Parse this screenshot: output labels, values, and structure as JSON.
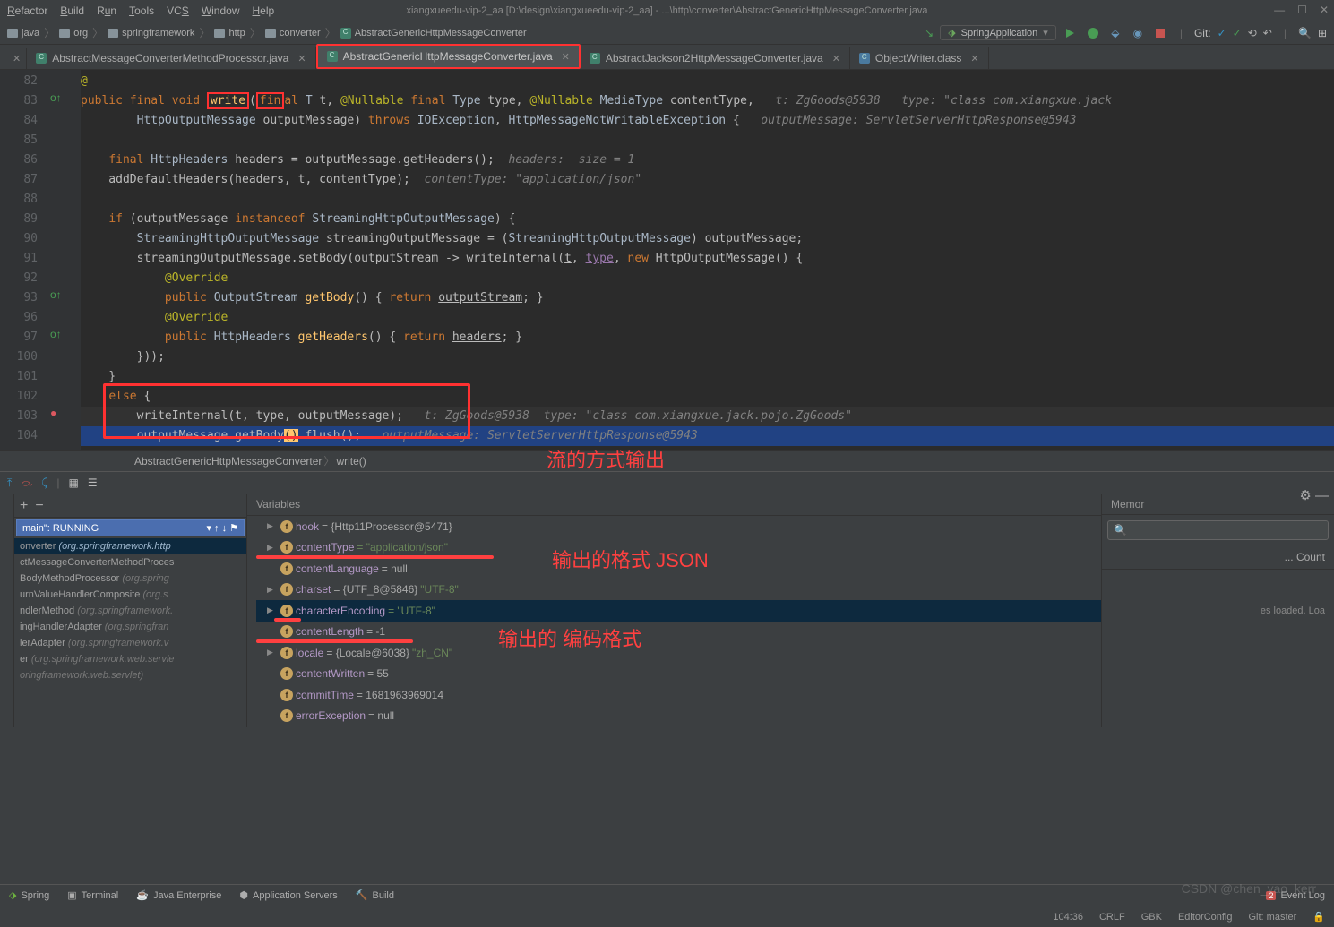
{
  "menubar": {
    "items": [
      "Refactor",
      "Build",
      "Run",
      "Tools",
      "VCS",
      "Window",
      "Help"
    ]
  },
  "window_title": "xiangxueedu-vip-2_aa [D:\\design\\xiangxueedu-vip-2_aa] - ...\\http\\converter\\AbstractGenericHttpMessageConverter.java",
  "breadcrumbs": [
    "java",
    "org",
    "springframework",
    "http",
    "converter",
    "AbstractGenericHttpMessageConverter"
  ],
  "run_config": {
    "name": "SpringApplication"
  },
  "git_label": "Git:",
  "tabs": [
    {
      "name": "AbstractMessageConverterMethodProcessor.java",
      "active": false
    },
    {
      "name": "AbstractGenericHttpMessageConverter.java",
      "active": true,
      "boxed": true
    },
    {
      "name": "AbstractJackson2HttpMessageConverter.java",
      "active": false
    },
    {
      "name": "ObjectWriter.class",
      "active": false,
      "icon": "class"
    }
  ],
  "code_breadcrumb": {
    "class": "AbstractGenericHttpMessageConverter",
    "method": "write()"
  },
  "lines": {
    "start": 82,
    "list": [
      82,
      83,
      84,
      85,
      86,
      87,
      88,
      89,
      90,
      91,
      92,
      93,
      96,
      97,
      100,
      101,
      102,
      103,
      104
    ]
  },
  "code_text": {
    "l82": "@",
    "l83_hint": "t: ZgGoods@5938   type: \"class com.xiangxue.jack",
    "l84_hint": "outputMessage: ServletServerHttpResponse@5943",
    "l86_hint": "headers:  size = 1",
    "l87_hint": "contentType: \"application/json\"",
    "l103_hint": "t: ZgGoods@5938  type: \"class com.xiangxue.jack.pojo.ZgGoods\"",
    "l104_hint": "outputMessage: ServletServerHttpResponse@5943"
  },
  "annotations": {
    "stream_output": "流的方式输出",
    "output_format": "输出的格式  JSON",
    "output_encoding": "输出的 编码格式"
  },
  "frames": {
    "dropdown": "main\": RUNNING",
    "items": [
      {
        "text": "onverter",
        "pkg": "(org.springframework.http",
        "sel": true
      },
      {
        "text": "ctMessageConverterMethodProces",
        "pkg": ""
      },
      {
        "text": "BodyMethodProcessor",
        "pkg": "(org.spring"
      },
      {
        "text": "urnValueHandlerComposite",
        "pkg": "(org.s"
      },
      {
        "text": "ndlerMethod",
        "pkg": "(org.springframework."
      },
      {
        "text": "ingHandlerAdapter",
        "pkg": "(org.springfran"
      },
      {
        "text": "lerAdapter",
        "pkg": "(org.springframework.v"
      },
      {
        "text": "er",
        "pkg": "(org.springframework.web.servle"
      },
      {
        "text": "oringframework.web.servlet)",
        "pkg": ""
      }
    ]
  },
  "variables": {
    "title": "Variables",
    "rows": [
      {
        "arrow": "▶",
        "name": "hook",
        "val": "= {Http11Processor@5471}"
      },
      {
        "arrow": "▶",
        "name": "contentType",
        "str": " = \"application/json\""
      },
      {
        "arrow": "",
        "name": "contentLanguage",
        "val": " = null"
      },
      {
        "arrow": "▶",
        "name": "charset",
        "val": " = {UTF_8@5846}",
        "str": " \"UTF-8\""
      },
      {
        "arrow": "▶",
        "name": "characterEncoding",
        "str": " = \"UTF-8\"",
        "sel": true
      },
      {
        "arrow": "",
        "name": "contentLength",
        "val": " = -1"
      },
      {
        "arrow": "▶",
        "name": "locale",
        "val": " = {Locale@6038}",
        "str": " \"zh_CN\""
      },
      {
        "arrow": "",
        "name": "contentWritten",
        "val": " = 55"
      },
      {
        "arrow": "",
        "name": "commitTime",
        "val": " = 1681963969014"
      },
      {
        "arrow": "",
        "name": "errorException",
        "val": " = null"
      }
    ]
  },
  "memory": {
    "title": "Memor",
    "count_header": "Count",
    "loaded": "es loaded. Loa"
  },
  "bottom_tools": [
    "Spring",
    "Terminal",
    "Java Enterprise",
    "Application Servers",
    "Build"
  ],
  "status": {
    "pos": "104:36",
    "crlf": "CRLF",
    "enc": "GBK",
    "ctx": "EditorConfig",
    "git": "Git: master",
    "event": "Event Log",
    "event_count": "2"
  },
  "watermark": "CSDN @chen_yao_kerr"
}
